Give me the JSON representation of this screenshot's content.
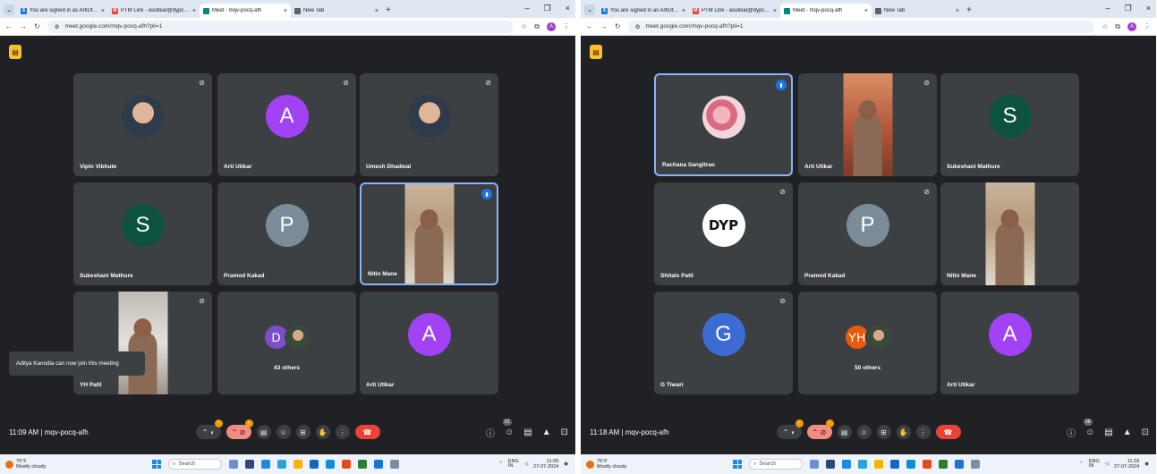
{
  "browser": {
    "tabs": [
      {
        "label": "You are signed in as ArtiUtikar",
        "favicon_color": "#1a73e8",
        "favicon_letter": "S"
      },
      {
        "label": "PTM Link - asutikar@dypcoesi",
        "favicon_color": "#ea4335",
        "favicon_letter": "M"
      },
      {
        "label": "Meet - mqv-pocq-afh",
        "favicon_color": "#00897b",
        "favicon_letter": "",
        "active": true
      },
      {
        "label": "New Tab",
        "favicon_color": "#5f6368",
        "favicon_letter": ""
      }
    ],
    "url": "meet.google.com/mqv-pocq-afh?pli=1",
    "profile_letter": "A"
  },
  "left": {
    "tiles": [
      {
        "name": "Vipin Vibhute",
        "kind": "photo",
        "muted": true
      },
      {
        "name": "Arti Utikar",
        "kind": "letter",
        "letter": "A",
        "color": "#a142f4",
        "muted": true
      },
      {
        "name": "Umesh Dhadwal",
        "kind": "photo",
        "muted": true
      },
      {
        "name": "Sukeshani Mathure",
        "kind": "letter",
        "letter": "S",
        "color": "#0d5240",
        "muted": false
      },
      {
        "name": "Pramod Kakad",
        "kind": "letter",
        "letter": "P",
        "color": "#7b8c99",
        "muted": false
      },
      {
        "name": "Nitin Mane",
        "kind": "video",
        "muted": false,
        "speaking": true
      },
      {
        "name": "YH Patil",
        "kind": "video",
        "muted": true
      },
      {
        "name": "43 others",
        "kind": "others",
        "letter": "D",
        "color": "#7b4fc9"
      },
      {
        "name": "Arti Utikar",
        "kind": "letter",
        "letter": "A",
        "color": "#a142f4",
        "muted": false
      }
    ],
    "toast": "Aditya Kanodia can now join this meeting",
    "time": "11:09 AM",
    "meeting_code": "mqv-pocq-afh",
    "people_count": "51",
    "clock_date": "27-07-2024",
    "clock_time": "11:09"
  },
  "right": {
    "tiles": [
      {
        "name": "Rachana Sangitrao",
        "kind": "flower",
        "speaking": true
      },
      {
        "name": "Arti Utikar",
        "kind": "video",
        "muted": true
      },
      {
        "name": "Sukeshani Mathure",
        "kind": "letter",
        "letter": "S",
        "color": "#0d5240"
      },
      {
        "name": "Shitals Patil",
        "kind": "logo",
        "letter": "DYP",
        "muted": true
      },
      {
        "name": "Pramod Kakad",
        "kind": "letter",
        "letter": "P",
        "color": "#7b8c99",
        "muted": true
      },
      {
        "name": "Nitin Mane",
        "kind": "video"
      },
      {
        "name": "G Tiwari",
        "kind": "letter",
        "letter": "G",
        "color": "#3d6bd4",
        "muted": true
      },
      {
        "name": "50 others",
        "kind": "others",
        "letter": "YH",
        "color": "#e8590c"
      },
      {
        "name": "Arti Utikar",
        "kind": "letter",
        "letter": "A",
        "color": "#a142f4"
      }
    ],
    "time": "11:18 AM",
    "meeting_code": "mqv-pocq-afh",
    "people_count": "58",
    "clock_date": "27-07-2024",
    "clock_time": "11:18"
  },
  "taskbar": {
    "temp": "75°F",
    "weather": "Mostly cloudy",
    "search": "Search",
    "lang": "ENG",
    "region": "IN"
  },
  "mic_badge": "!"
}
